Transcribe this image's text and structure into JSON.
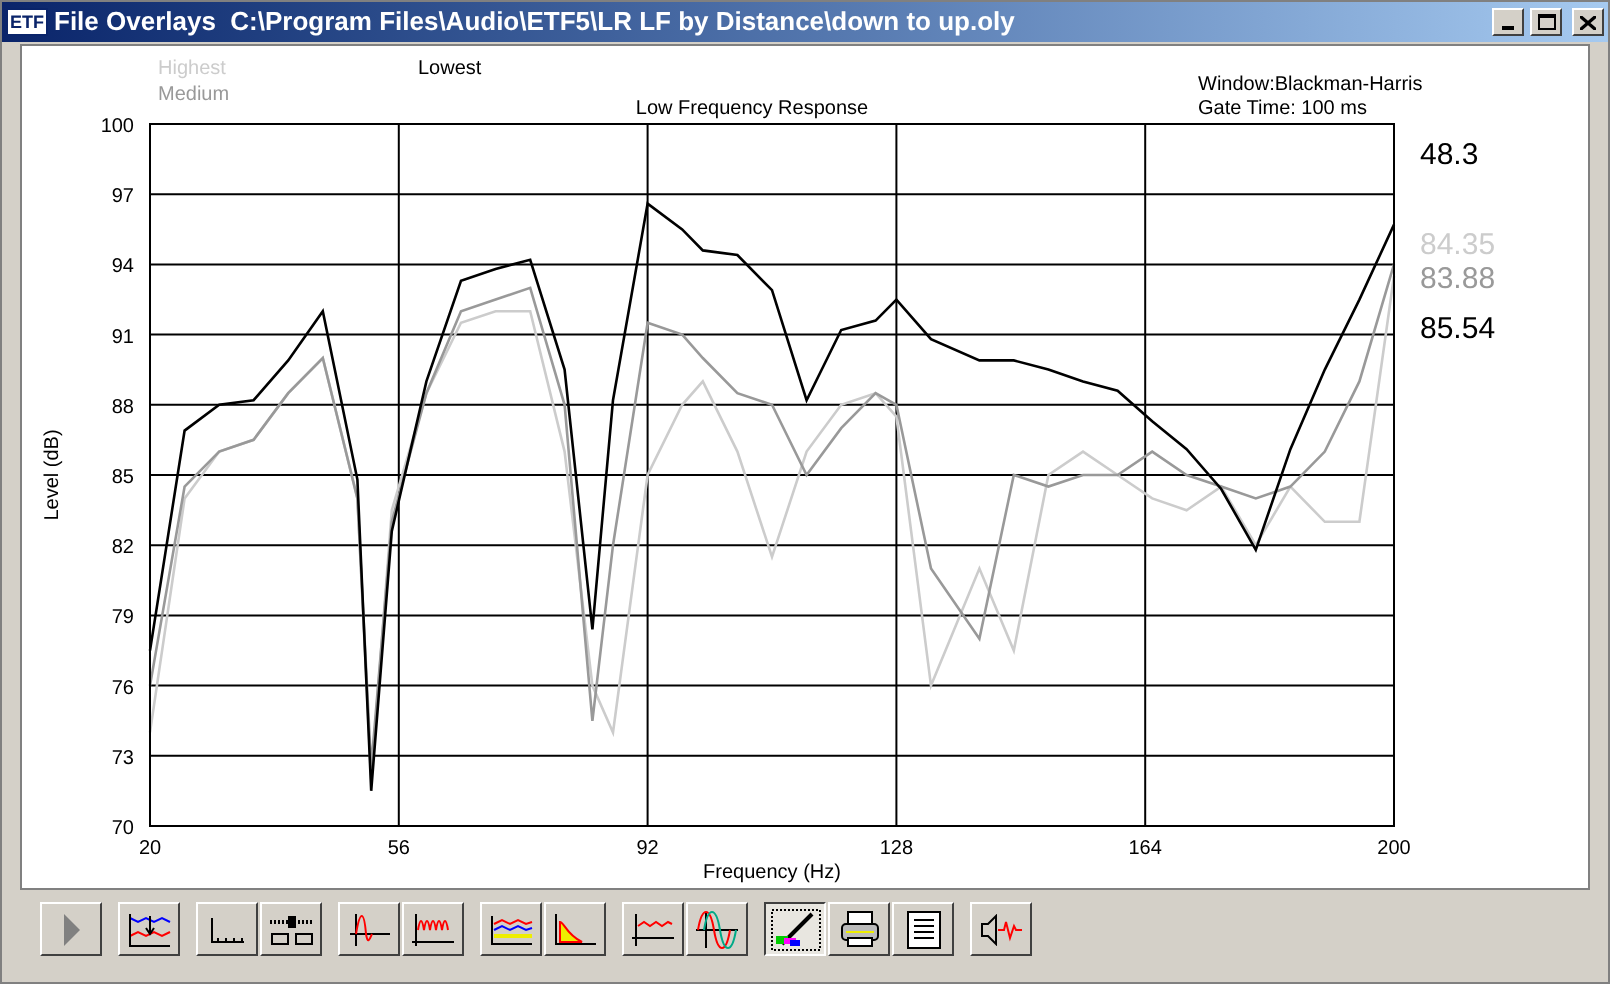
{
  "window": {
    "title": "File Overlays  C:\\Program Files\\Audio\\ETF5\\LR LF by Distance\\down to up.oly",
    "logo": "ETF"
  },
  "analysis_info": [
    "Window:Blackman-Harris",
    "Gate Time: 100 ms"
  ],
  "readouts": [
    {
      "text": "48.3",
      "color": "#000000"
    },
    {
      "text": "84.35",
      "color": "#cccccc"
    },
    {
      "text": "83.88",
      "color": "#999999"
    },
    {
      "text": "85.54",
      "color": "#000000"
    }
  ],
  "chart_data": {
    "type": "line",
    "title": "Low Frequency Response",
    "xlabel": "Frequency (Hz)",
    "ylabel": "Level (dB)",
    "x": [
      20,
      25,
      30,
      35,
      40,
      45,
      50,
      52,
      55,
      60,
      65,
      70,
      75,
      80,
      84,
      87,
      92,
      97,
      100,
      105,
      110,
      115,
      120,
      125,
      128,
      133,
      140,
      145,
      150,
      155,
      160,
      165,
      170,
      175,
      180,
      185,
      190,
      195,
      200
    ],
    "series": [
      {
        "name": "Highest",
        "color": "#cccccc",
        "values": [
          74,
          84,
          86,
          86.5,
          88.5,
          90,
          84,
          72,
          83.5,
          88.5,
          91.5,
          92,
          92,
          86,
          76,
          74,
          85,
          88,
          89,
          86,
          81.5,
          86,
          88,
          88.5,
          87.5,
          76,
          81,
          77.5,
          85,
          86,
          85,
          84,
          83.5,
          84.5,
          82,
          84.5,
          83,
          83,
          93.5
        ]
      },
      {
        "name": "Medium",
        "color": "#999999",
        "values": [
          76,
          84.5,
          86,
          86.5,
          88.5,
          90,
          84,
          72.5,
          83,
          88.5,
          92,
          92.5,
          93,
          88,
          74.5,
          82,
          91.5,
          91,
          90,
          88.5,
          88,
          85,
          87,
          88.5,
          88,
          81,
          78,
          85,
          84.5,
          85,
          85,
          86,
          85,
          84.5,
          84,
          84.5,
          86,
          89,
          94
        ]
      },
      {
        "name": "Lowest",
        "color": "#000000",
        "values": [
          77.5,
          86.9,
          88,
          88.2,
          89.9,
          92,
          84.8,
          71.5,
          82.6,
          89,
          93.3,
          93.8,
          94.2,
          89.5,
          78.4,
          88.2,
          96.6,
          95.5,
          94.6,
          94.4,
          92.9,
          88.2,
          91.2,
          91.6,
          92.5,
          90.8,
          89.9,
          89.9,
          89.5,
          89,
          88.6,
          87.3,
          86.1,
          84.4,
          81.8,
          86.1,
          89.5,
          92.5,
          95.7
        ]
      }
    ],
    "grid": true,
    "xlim": [
      20,
      200
    ],
    "ylim": [
      70,
      100
    ],
    "xticks": [
      20,
      56,
      92,
      128,
      164,
      200
    ],
    "yticks": [
      70,
      73,
      76,
      79,
      82,
      85,
      88,
      91,
      94,
      97,
      100
    ]
  },
  "toolbar": [
    [
      {
        "kind": "play",
        "pressed": false
      }
    ],
    [
      {
        "kind": "overlay",
        "pressed": false
      }
    ],
    [
      {
        "kind": "axis",
        "pressed": false
      },
      {
        "kind": "slider",
        "pressed": false
      }
    ],
    [
      {
        "kind": "impulse",
        "pressed": false
      },
      {
        "kind": "ringing",
        "pressed": false
      }
    ],
    [
      {
        "kind": "multiline",
        "pressed": false
      },
      {
        "kind": "decay",
        "pressed": false
      }
    ],
    [
      {
        "kind": "response",
        "pressed": false
      },
      {
        "kind": "sine",
        "pressed": false
      }
    ],
    [
      {
        "kind": "pen",
        "pressed": true
      },
      {
        "kind": "printer",
        "pressed": false
      },
      {
        "kind": "document",
        "pressed": false
      }
    ],
    [
      {
        "kind": "speaker",
        "pressed": false
      }
    ]
  ]
}
